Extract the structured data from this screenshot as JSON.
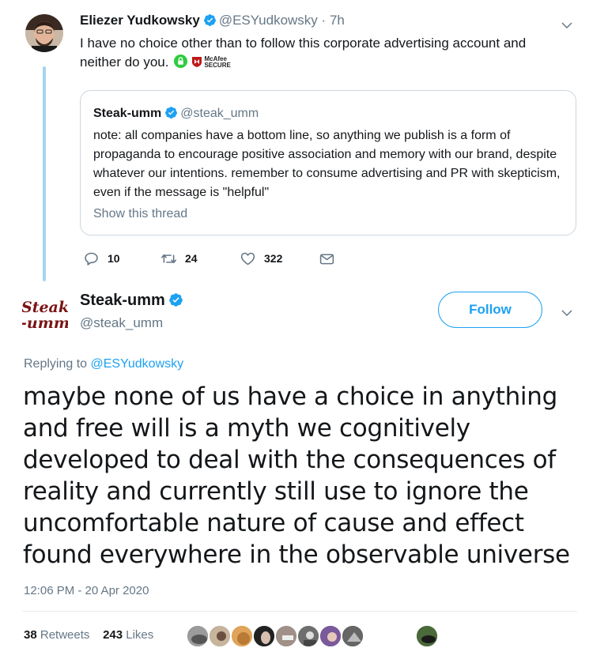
{
  "parent_tweet": {
    "author_name": "Eliezer Yudkowsky",
    "author_handle": "@ESYudkowsky",
    "separator": "·",
    "time_ago": "7h",
    "text": "I have no choice other than to follow this corporate advertising account and neither do you.",
    "mcafee_label_line1": "McAfee",
    "mcafee_label_line2": "SECURE",
    "quoted": {
      "author_name": "Steak-umm",
      "author_handle": "@steak_umm",
      "text": "note: all companies have a bottom line, so anything we publish is a form of propaganda to encourage positive association and memory with our brand, despite whatever our intentions. remember to consume advertising and PR with skepticism, even if the message is \"helpful\"",
      "show_thread": "Show this thread"
    },
    "actions": {
      "replies": "10",
      "retweets": "24",
      "likes": "322"
    }
  },
  "main_tweet": {
    "logo_text_line1": "Steak",
    "logo_text_line2": "-umm",
    "author_name": "Steak-umm",
    "author_handle": "@steak_umm",
    "follow_label": "Follow",
    "replying_prefix": "Replying to ",
    "replying_handle": "@ESYudkowsky",
    "text": "maybe none of us have a choice in anything and free will is a myth we cognitively developed to deal with the consequences of reality and currently still use to ignore the uncomfortable nature of cause and effect found everywhere in the observable universe",
    "timestamp": "12:06 PM - 20 Apr 2020",
    "retweet_count": "38",
    "retweet_label": " Retweets",
    "like_count": "243",
    "like_label": " Likes"
  },
  "colors": {
    "accent": "#1da1f2",
    "thread_line": "#a8d3f0",
    "secondary_text": "#657786",
    "primary_text": "#14171a",
    "border": "#ccd6dd"
  }
}
